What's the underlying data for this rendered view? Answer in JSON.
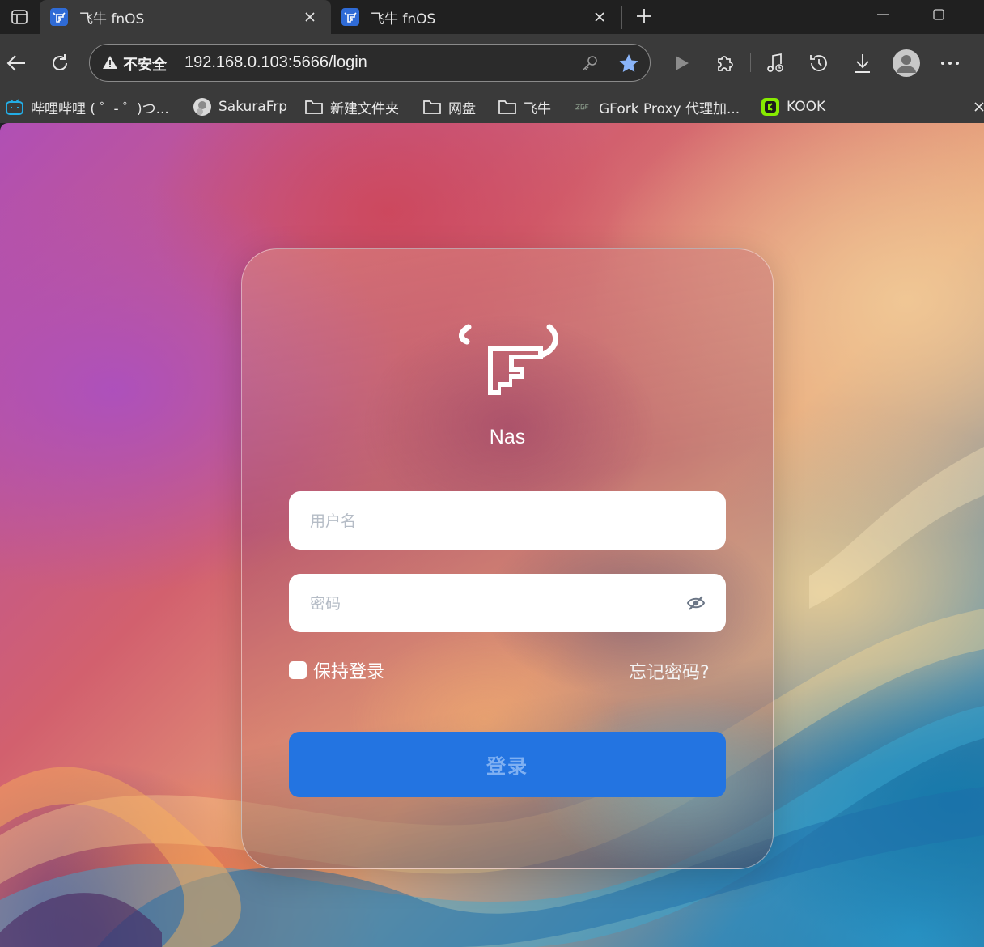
{
  "tabs": [
    {
      "title": "飞牛 fnOS",
      "active": true
    },
    {
      "title": "飞牛 fnOS",
      "active": false
    }
  ],
  "omnibox": {
    "security_label": "不安全",
    "url": "192.168.0.103:5666/login"
  },
  "bookmarks": [
    {
      "label": "哔哩哔哩 ( ゜- ゜)つ...",
      "icon": "bilibili-icon"
    },
    {
      "label": "SakuraFrp",
      "icon": "avatar-icon"
    },
    {
      "label": "新建文件夹",
      "icon": "folder-icon"
    },
    {
      "label": "网盘",
      "icon": "folder-icon"
    },
    {
      "label": "飞牛",
      "icon": "folder-icon"
    },
    {
      "label": "GFork Proxy 代理加...",
      "icon": "zgf-icon"
    },
    {
      "label": "KOOK",
      "icon": "kook-icon"
    }
  ],
  "login": {
    "server_name": "Nas",
    "username_placeholder": "用户名",
    "password_placeholder": "密码",
    "remember_label": "保持登录",
    "remember_checked": false,
    "forgot_label": "忘记密码?",
    "submit_label": "登录"
  },
  "colors": {
    "accent": "#2374e1",
    "favicon": "#2f6bd6",
    "star": "#8ab4f8"
  }
}
